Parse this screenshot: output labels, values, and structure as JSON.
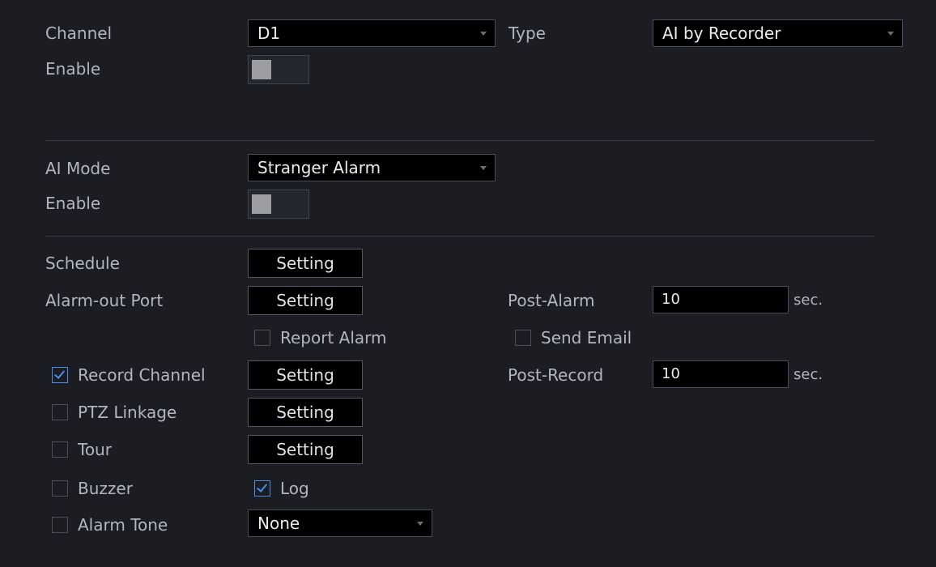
{
  "channel": {
    "label": "Channel",
    "value": "D1"
  },
  "type": {
    "label": "Type",
    "value": "AI by Recorder"
  },
  "enable1": {
    "label": "Enable"
  },
  "ai_mode": {
    "label": "AI Mode",
    "value": "Stranger Alarm"
  },
  "enable2": {
    "label": "Enable"
  },
  "schedule": {
    "label": "Schedule",
    "button": "Setting"
  },
  "alarm_out": {
    "label": "Alarm-out Port",
    "button": "Setting"
  },
  "post_alarm": {
    "label": "Post-Alarm",
    "value": "10",
    "unit": "sec."
  },
  "report_alarm": {
    "label": "Report Alarm",
    "checked": false
  },
  "send_email": {
    "label": "Send Email",
    "checked": false
  },
  "record_channel": {
    "label": "Record Channel",
    "checked": true,
    "button": "Setting"
  },
  "post_record": {
    "label": "Post-Record",
    "value": "10",
    "unit": "sec."
  },
  "ptz_linkage": {
    "label": "PTZ Linkage",
    "checked": false,
    "button": "Setting"
  },
  "tour": {
    "label": "Tour",
    "checked": false,
    "button": "Setting"
  },
  "buzzer": {
    "label": "Buzzer",
    "checked": false
  },
  "log": {
    "label": "Log",
    "checked": true
  },
  "alarm_tone": {
    "label": "Alarm Tone",
    "checked": false,
    "value": "None"
  },
  "colors": {
    "background": "#1b1d22",
    "accent": "#4a90e2"
  }
}
